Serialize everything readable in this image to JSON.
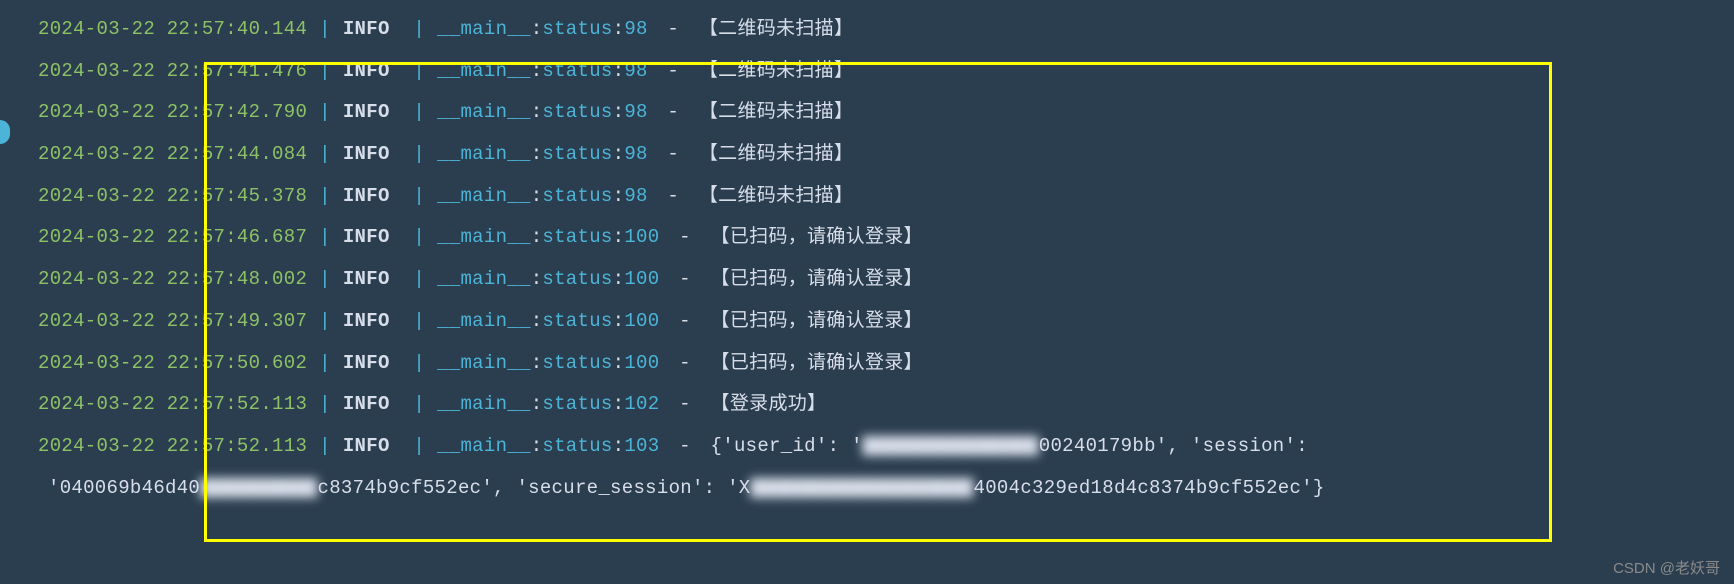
{
  "logs": [
    {
      "timestamp": "2024-03-22 22:57:40.144",
      "level": "INFO",
      "module": "__main__",
      "func": "status",
      "lineno": "98",
      "message": "【二维码未扫描】"
    },
    {
      "timestamp": "2024-03-22 22:57:41.476",
      "level": "INFO",
      "module": "__main__",
      "func": "status",
      "lineno": "98",
      "message": "【二维码未扫描】"
    },
    {
      "timestamp": "2024-03-22 22:57:42.790",
      "level": "INFO",
      "module": "__main__",
      "func": "status",
      "lineno": "98",
      "message": "【二维码未扫描】"
    },
    {
      "timestamp": "2024-03-22 22:57:44.084",
      "level": "INFO",
      "module": "__main__",
      "func": "status",
      "lineno": "98",
      "message": "【二维码未扫描】"
    },
    {
      "timestamp": "2024-03-22 22:57:45.378",
      "level": "INFO",
      "module": "__main__",
      "func": "status",
      "lineno": "98",
      "message": "【二维码未扫描】"
    },
    {
      "timestamp": "2024-03-22 22:57:46.687",
      "level": "INFO",
      "module": "__main__",
      "func": "status",
      "lineno": "100",
      "message": "【已扫码，请确认登录】"
    },
    {
      "timestamp": "2024-03-22 22:57:48.002",
      "level": "INFO",
      "module": "__main__",
      "func": "status",
      "lineno": "100",
      "message": "【已扫码，请确认登录】"
    },
    {
      "timestamp": "2024-03-22 22:57:49.307",
      "level": "INFO",
      "module": "__main__",
      "func": "status",
      "lineno": "100",
      "message": "【已扫码，请确认登录】"
    },
    {
      "timestamp": "2024-03-22 22:57:50.602",
      "level": "INFO",
      "module": "__main__",
      "func": "status",
      "lineno": "100",
      "message": "【已扫码，请确认登录】"
    },
    {
      "timestamp": "2024-03-22 22:57:52.113",
      "level": "INFO",
      "module": "__main__",
      "func": "status",
      "lineno": "102",
      "message": "【登录成功】"
    }
  ],
  "final_log": {
    "timestamp": "2024-03-22 22:57:52.113",
    "level": "INFO",
    "module": "__main__",
    "func": "status",
    "lineno": "103",
    "msg_part1": "{'user_id': '",
    "msg_blur1": "▇▇▇▇▇▇▇▇▇▇▇▇▇▇▇",
    "msg_part2": "00240179bb', 'session':",
    "cont_part1": "'040069b46d40",
    "cont_blur1": "▇▇▇▇▇▇▇▇▇▇",
    "cont_part2": "c8374b9cf552ec', 'secure_session': 'X",
    "cont_blur2": "▇▇▇▇▇▇▇▇▇▇▇▇▇▇▇▇▇▇▇",
    "cont_part3": "4004c329ed18d4c8374b9cf552ec'}"
  },
  "watermark": "CSDN @老妖哥"
}
